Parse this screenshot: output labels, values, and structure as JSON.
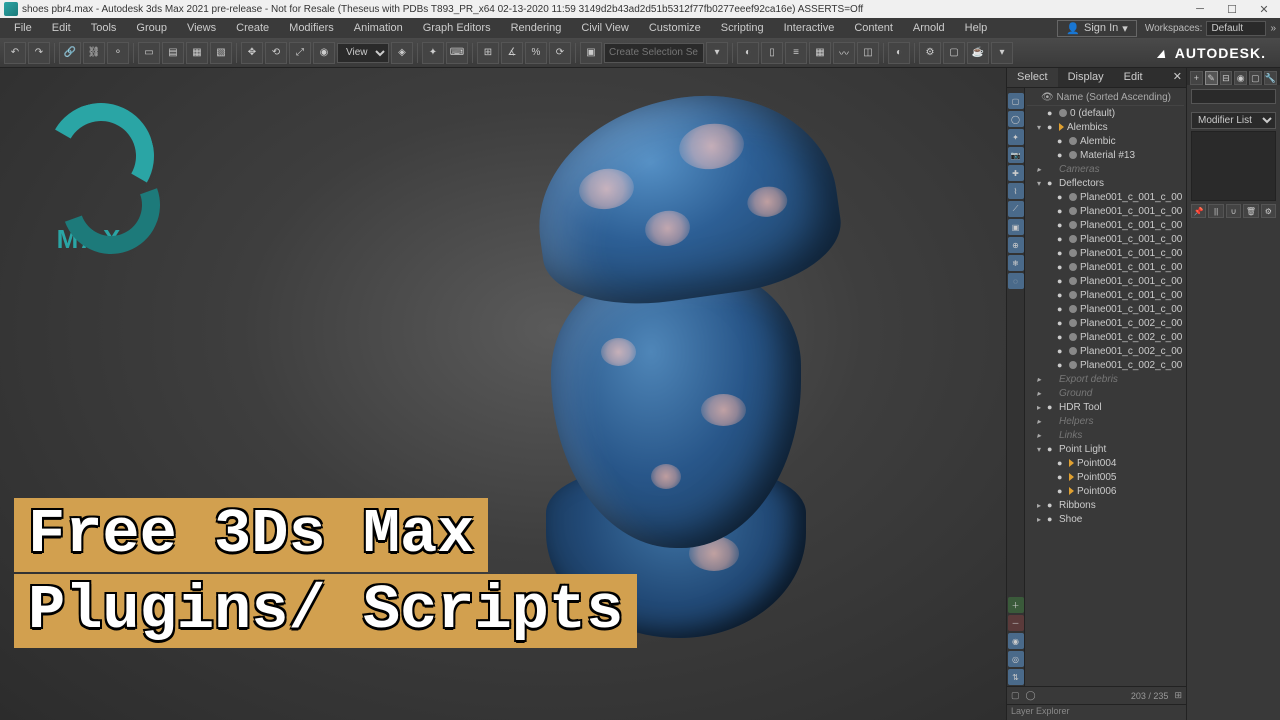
{
  "titlebar": {
    "text": "shoes pbr4.max - Autodesk 3ds Max 2021 pre-release - Not for Resale (Theseus with PDBs T893_PR_x64 02-13-2020 11:59 3149d2b43ad2d51b5312f77fb0277eeef92ca16e) ASSERTS=Off"
  },
  "menu": [
    "File",
    "Edit",
    "Tools",
    "Group",
    "Views",
    "Create",
    "Modifiers",
    "Animation",
    "Graph Editors",
    "Rendering",
    "Civil View",
    "Customize",
    "Scripting",
    "Interactive",
    "Content",
    "Arnold",
    "Help"
  ],
  "signin": "Sign In",
  "workspace_label": "Workspaces:",
  "workspace_value": "Default",
  "view_label": "View",
  "selection_placeholder": "Create Selection Se",
  "autodesk": "AUTODESK.",
  "logo_text": "MAX",
  "overlay": {
    "line1": "Free 3Ds Max",
    "line2": "Plugins/ Scripts"
  },
  "scene": {
    "tabs": [
      "Select",
      "Display",
      "Edit"
    ],
    "header": "Name (Sorted Ascending)",
    "items": [
      {
        "d": 1,
        "t": "0 (default)",
        "exp": "",
        "eye": "●",
        "dim": false,
        "ico": "dot"
      },
      {
        "d": 1,
        "t": "Alembics",
        "exp": "▾",
        "eye": "●",
        "dim": false,
        "ico": "geom"
      },
      {
        "d": 2,
        "t": "Alembic",
        "exp": "",
        "eye": "●",
        "dim": false,
        "ico": "dot"
      },
      {
        "d": 2,
        "t": "Material #13",
        "exp": "",
        "eye": "●",
        "dim": false,
        "ico": "dot"
      },
      {
        "d": 1,
        "t": "Cameras",
        "exp": "▸",
        "eye": "",
        "dim": true,
        "ico": ""
      },
      {
        "d": 1,
        "t": "Deflectors",
        "exp": "▾",
        "eye": "●",
        "dim": false,
        "ico": ""
      },
      {
        "d": 2,
        "t": "Plane001_c_001_c_00",
        "exp": "",
        "eye": "●",
        "dim": false,
        "ico": "dot"
      },
      {
        "d": 2,
        "t": "Plane001_c_001_c_00",
        "exp": "",
        "eye": "●",
        "dim": false,
        "ico": "dot"
      },
      {
        "d": 2,
        "t": "Plane001_c_001_c_00",
        "exp": "",
        "eye": "●",
        "dim": false,
        "ico": "dot"
      },
      {
        "d": 2,
        "t": "Plane001_c_001_c_00",
        "exp": "",
        "eye": "●",
        "dim": false,
        "ico": "dot"
      },
      {
        "d": 2,
        "t": "Plane001_c_001_c_00",
        "exp": "",
        "eye": "●",
        "dim": false,
        "ico": "dot"
      },
      {
        "d": 2,
        "t": "Plane001_c_001_c_00",
        "exp": "",
        "eye": "●",
        "dim": false,
        "ico": "dot"
      },
      {
        "d": 2,
        "t": "Plane001_c_001_c_00",
        "exp": "",
        "eye": "●",
        "dim": false,
        "ico": "dot"
      },
      {
        "d": 2,
        "t": "Plane001_c_001_c_00",
        "exp": "",
        "eye": "●",
        "dim": false,
        "ico": "dot"
      },
      {
        "d": 2,
        "t": "Plane001_c_001_c_00",
        "exp": "",
        "eye": "●",
        "dim": false,
        "ico": "dot"
      },
      {
        "d": 2,
        "t": "Plane001_c_002_c_00",
        "exp": "",
        "eye": "●",
        "dim": false,
        "ico": "dot"
      },
      {
        "d": 2,
        "t": "Plane001_c_002_c_00",
        "exp": "",
        "eye": "●",
        "dim": false,
        "ico": "dot"
      },
      {
        "d": 2,
        "t": "Plane001_c_002_c_00",
        "exp": "",
        "eye": "●",
        "dim": false,
        "ico": "dot"
      },
      {
        "d": 2,
        "t": "Plane001_c_002_c_00",
        "exp": "",
        "eye": "●",
        "dim": false,
        "ico": "dot"
      },
      {
        "d": 1,
        "t": "Export debris",
        "exp": "▸",
        "eye": "",
        "dim": true,
        "ico": ""
      },
      {
        "d": 1,
        "t": "Ground",
        "exp": "▸",
        "eye": "",
        "dim": true,
        "ico": ""
      },
      {
        "d": 1,
        "t": "HDR Tool",
        "exp": "▸",
        "eye": "●",
        "dim": false,
        "ico": ""
      },
      {
        "d": 1,
        "t": "Helpers",
        "exp": "▸",
        "eye": "",
        "dim": true,
        "ico": ""
      },
      {
        "d": 1,
        "t": "Links",
        "exp": "▸",
        "eye": "",
        "dim": true,
        "ico": ""
      },
      {
        "d": 1,
        "t": "Point Light",
        "exp": "▾",
        "eye": "●",
        "dim": false,
        "ico": ""
      },
      {
        "d": 2,
        "t": "Point004",
        "exp": "",
        "eye": "●",
        "dim": false,
        "ico": "geom"
      },
      {
        "d": 2,
        "t": "Point005",
        "exp": "",
        "eye": "●",
        "dim": false,
        "ico": "geom"
      },
      {
        "d": 2,
        "t": "Point006",
        "exp": "",
        "eye": "●",
        "dim": false,
        "ico": "geom"
      },
      {
        "d": 1,
        "t": "Ribbons",
        "exp": "▸",
        "eye": "●",
        "dim": false,
        "ico": ""
      },
      {
        "d": 1,
        "t": "Shoe",
        "exp": "▸",
        "eye": "●",
        "dim": false,
        "ico": ""
      }
    ],
    "status": "203 / 235",
    "footer": "Layer Explorer"
  },
  "command": {
    "modifier_label": "Modifier List"
  }
}
